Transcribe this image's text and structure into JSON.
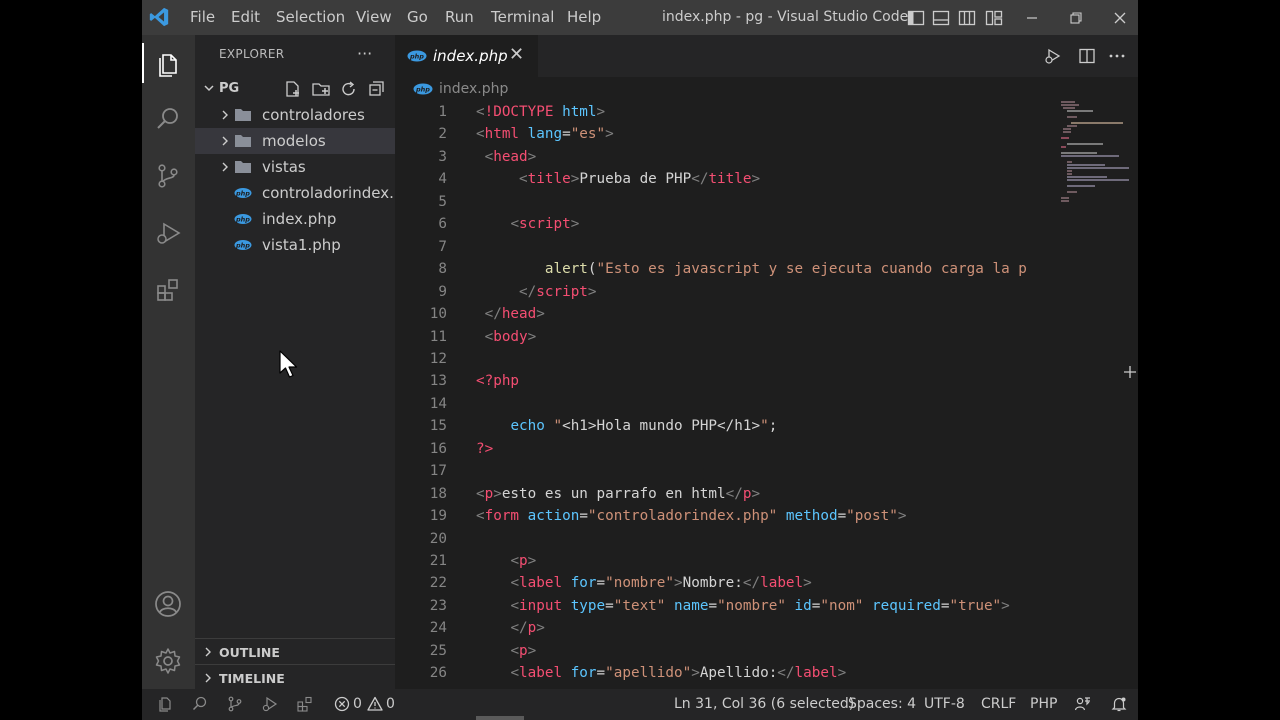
{
  "title_bar": {
    "menu": [
      "File",
      "Edit",
      "Selection",
      "View",
      "Go",
      "Run",
      "Terminal",
      "Help"
    ],
    "window_title": "index.php - pg - Visual Studio Code"
  },
  "activity_bar": {
    "icons": [
      "files-icon",
      "search-icon",
      "source-control-icon",
      "run-debug-icon",
      "extensions-icon",
      "accounts-icon",
      "settings-gear-icon"
    ]
  },
  "sidebar": {
    "title": "EXPLORER",
    "more": "···",
    "folder": "PG",
    "items": [
      {
        "label": "controladores",
        "type": "folder"
      },
      {
        "label": "modelos",
        "type": "folder"
      },
      {
        "label": "vistas",
        "type": "folder"
      },
      {
        "label": "controladorindex....",
        "type": "php"
      },
      {
        "label": "index.php",
        "type": "php"
      },
      {
        "label": "vista1.php",
        "type": "php"
      }
    ],
    "panels": [
      "OUTLINE",
      "TIMELINE"
    ]
  },
  "editor": {
    "tab_label": "index.php",
    "close_glyph": "✕",
    "breadcrumb": "index.php",
    "lines": [
      {
        "n": "1",
        "tokens": [
          [
            "p",
            "<"
          ],
          [
            "t",
            "!DOCTYPE"
          ],
          [
            "x",
            " "
          ],
          [
            "a",
            "html"
          ],
          [
            "p",
            ">"
          ]
        ]
      },
      {
        "n": "2",
        "tokens": [
          [
            "p",
            "<"
          ],
          [
            "t",
            "html"
          ],
          [
            "x",
            " "
          ],
          [
            "a",
            "lang"
          ],
          [
            "x",
            "="
          ],
          [
            "s",
            "\"es\""
          ],
          [
            "p",
            ">"
          ]
        ]
      },
      {
        "n": "3",
        "tokens": [
          [
            "x",
            " "
          ],
          [
            "p",
            "<"
          ],
          [
            "t",
            "head"
          ],
          [
            "p",
            ">"
          ]
        ]
      },
      {
        "n": "4",
        "tokens": [
          [
            "x",
            "     "
          ],
          [
            "p",
            "<"
          ],
          [
            "t",
            "title"
          ],
          [
            "p",
            ">"
          ],
          [
            "x",
            "Prueba de PHP"
          ],
          [
            "p",
            "</"
          ],
          [
            "t",
            "title"
          ],
          [
            "p",
            ">"
          ]
        ]
      },
      {
        "n": "5",
        "tokens": []
      },
      {
        "n": "6",
        "tokens": [
          [
            "x",
            "    "
          ],
          [
            "p",
            "<"
          ],
          [
            "t",
            "script"
          ],
          [
            "p",
            ">"
          ]
        ]
      },
      {
        "n": "7",
        "tokens": []
      },
      {
        "n": "8",
        "tokens": [
          [
            "x",
            "        "
          ],
          [
            "f",
            "alert"
          ],
          [
            "x",
            "("
          ],
          [
            "s",
            "\"Esto es javascript y se ejecuta cuando carga la p"
          ]
        ]
      },
      {
        "n": "9",
        "tokens": [
          [
            "x",
            "     "
          ],
          [
            "p",
            "</"
          ],
          [
            "t",
            "script"
          ],
          [
            "p",
            ">"
          ]
        ]
      },
      {
        "n": "10",
        "tokens": [
          [
            "x",
            " "
          ],
          [
            "p",
            "</"
          ],
          [
            "t",
            "head"
          ],
          [
            "p",
            ">"
          ]
        ]
      },
      {
        "n": "11",
        "tokens": [
          [
            "x",
            " "
          ],
          [
            "p",
            "<"
          ],
          [
            "t",
            "body"
          ],
          [
            "p",
            ">"
          ]
        ]
      },
      {
        "n": "12",
        "tokens": []
      },
      {
        "n": "13",
        "tokens": [
          [
            "h",
            "<?php"
          ]
        ]
      },
      {
        "n": "14",
        "tokens": []
      },
      {
        "n": "15",
        "tokens": [
          [
            "x",
            "    "
          ],
          [
            "k",
            "echo"
          ],
          [
            "x",
            " "
          ],
          [
            "s",
            "\""
          ],
          [
            "x",
            "<h1>Hola mundo PHP</h1>"
          ],
          [
            "s",
            "\""
          ],
          [
            "x",
            ";"
          ]
        ]
      },
      {
        "n": "16",
        "tokens": [
          [
            "h",
            "?>"
          ]
        ]
      },
      {
        "n": "17",
        "tokens": []
      },
      {
        "n": "18",
        "tokens": [
          [
            "p",
            "<"
          ],
          [
            "t",
            "p"
          ],
          [
            "p",
            ">"
          ],
          [
            "x",
            "esto es un parrafo en html"
          ],
          [
            "p",
            "</"
          ],
          [
            "t",
            "p"
          ],
          [
            "p",
            ">"
          ]
        ]
      },
      {
        "n": "19",
        "tokens": [
          [
            "p",
            "<"
          ],
          [
            "t",
            "form"
          ],
          [
            "x",
            " "
          ],
          [
            "a",
            "action"
          ],
          [
            "x",
            "="
          ],
          [
            "s",
            "\"controladorindex.php\""
          ],
          [
            "x",
            " "
          ],
          [
            "a",
            "method"
          ],
          [
            "x",
            "="
          ],
          [
            "s",
            "\"post\""
          ],
          [
            "p",
            ">"
          ]
        ]
      },
      {
        "n": "20",
        "tokens": []
      },
      {
        "n": "21",
        "tokens": [
          [
            "x",
            "    "
          ],
          [
            "p",
            "<"
          ],
          [
            "t",
            "p"
          ],
          [
            "p",
            ">"
          ]
        ]
      },
      {
        "n": "22",
        "tokens": [
          [
            "x",
            "    "
          ],
          [
            "p",
            "<"
          ],
          [
            "t",
            "label"
          ],
          [
            "x",
            " "
          ],
          [
            "a",
            "for"
          ],
          [
            "x",
            "="
          ],
          [
            "s",
            "\"nombre\""
          ],
          [
            "p",
            ">"
          ],
          [
            "x",
            "Nombre:"
          ],
          [
            "p",
            "</"
          ],
          [
            "t",
            "label"
          ],
          [
            "p",
            ">"
          ]
        ]
      },
      {
        "n": "23",
        "tokens": [
          [
            "x",
            "    "
          ],
          [
            "p",
            "<"
          ],
          [
            "t",
            "input"
          ],
          [
            "x",
            " "
          ],
          [
            "a",
            "type"
          ],
          [
            "x",
            "="
          ],
          [
            "s",
            "\"text\""
          ],
          [
            "x",
            " "
          ],
          [
            "a",
            "name"
          ],
          [
            "x",
            "="
          ],
          [
            "s",
            "\"nombre\""
          ],
          [
            "x",
            " "
          ],
          [
            "a",
            "id"
          ],
          [
            "x",
            "="
          ],
          [
            "s",
            "\"nom\""
          ],
          [
            "x",
            " "
          ],
          [
            "a",
            "required"
          ],
          [
            "x",
            "="
          ],
          [
            "s",
            "\"true\""
          ],
          [
            "p",
            ">"
          ]
        ]
      },
      {
        "n": "24",
        "tokens": [
          [
            "x",
            "    "
          ],
          [
            "p",
            "</"
          ],
          [
            "t",
            "p"
          ],
          [
            "p",
            ">"
          ]
        ]
      },
      {
        "n": "25",
        "tokens": [
          [
            "x",
            "    "
          ],
          [
            "p",
            "<"
          ],
          [
            "t",
            "p"
          ],
          [
            "p",
            ">"
          ]
        ]
      },
      {
        "n": "26",
        "tokens": [
          [
            "x",
            "    "
          ],
          [
            "p",
            "<"
          ],
          [
            "t",
            "label"
          ],
          [
            "x",
            " "
          ],
          [
            "a",
            "for"
          ],
          [
            "x",
            "="
          ],
          [
            "s",
            "\"apellido\""
          ],
          [
            "p",
            ">"
          ],
          [
            "x",
            "Apellido:"
          ],
          [
            "p",
            "</"
          ],
          [
            "t",
            "label"
          ],
          [
            "p",
            ">"
          ]
        ]
      }
    ]
  },
  "status_bar": {
    "errors": "0",
    "warnings": "0",
    "position": "Ln 31, Col 36 (6 selected)",
    "spaces": "Spaces: 4",
    "encoding": "UTF-8",
    "eol": "CRLF",
    "language": "PHP"
  },
  "colors": {
    "title_bar": "#3c3c3c",
    "activity_bar": "#333333",
    "sidebar": "#252526",
    "editor": "#1e1e1e",
    "tag": "#f44e72",
    "attribute": "#5cc5fe",
    "string": "#ce9178",
    "function": "#dcdcaa",
    "vscode_blue": "#3b99e0"
  }
}
